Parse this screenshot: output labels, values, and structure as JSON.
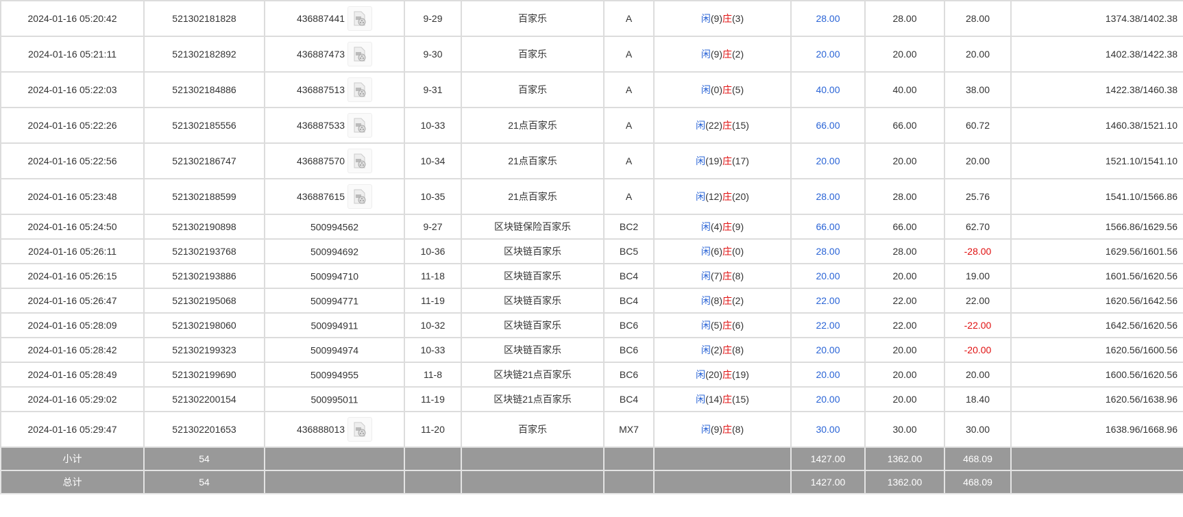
{
  "colors": {
    "player": "#2a64d6",
    "banker": "#e01010",
    "summary_bg": "#999999"
  },
  "labels": {
    "player": "闲",
    "banker": "庄"
  },
  "rows": [
    {
      "time": "2024-01-16 05:20:42",
      "order": "521302181828",
      "round": "436887441",
      "video": true,
      "shoe": "9-29",
      "game": "百家乐",
      "table": "A",
      "player": "9",
      "banker": "3",
      "bet": "28.00",
      "valid": "28.00",
      "win": "28.00",
      "neg": false,
      "balance": "1374.38/1402.38"
    },
    {
      "time": "2024-01-16 05:21:11",
      "order": "521302182892",
      "round": "436887473",
      "video": true,
      "shoe": "9-30",
      "game": "百家乐",
      "table": "A",
      "player": "9",
      "banker": "2",
      "bet": "20.00",
      "valid": "20.00",
      "win": "20.00",
      "neg": false,
      "balance": "1402.38/1422.38"
    },
    {
      "time": "2024-01-16 05:22:03",
      "order": "521302184886",
      "round": "436887513",
      "video": true,
      "shoe": "9-31",
      "game": "百家乐",
      "table": "A",
      "player": "0",
      "banker": "5",
      "bet": "40.00",
      "valid": "40.00",
      "win": "38.00",
      "neg": false,
      "balance": "1422.38/1460.38"
    },
    {
      "time": "2024-01-16 05:22:26",
      "order": "521302185556",
      "round": "436887533",
      "video": true,
      "shoe": "10-33",
      "game": "21点百家乐",
      "table": "A",
      "player": "22",
      "banker": "15",
      "bet": "66.00",
      "valid": "66.00",
      "win": "60.72",
      "neg": false,
      "balance": "1460.38/1521.10"
    },
    {
      "time": "2024-01-16 05:22:56",
      "order": "521302186747",
      "round": "436887570",
      "video": true,
      "shoe": "10-34",
      "game": "21点百家乐",
      "table": "A",
      "player": "19",
      "banker": "17",
      "bet": "20.00",
      "valid": "20.00",
      "win": "20.00",
      "neg": false,
      "balance": "1521.10/1541.10"
    },
    {
      "time": "2024-01-16 05:23:48",
      "order": "521302188599",
      "round": "436887615",
      "video": true,
      "shoe": "10-35",
      "game": "21点百家乐",
      "table": "A",
      "player": "12",
      "banker": "20",
      "bet": "28.00",
      "valid": "28.00",
      "win": "25.76",
      "neg": false,
      "balance": "1541.10/1566.86"
    },
    {
      "time": "2024-01-16 05:24:50",
      "order": "521302190898",
      "round": "500994562",
      "video": false,
      "shoe": "9-27",
      "game": "区块链保险百家乐",
      "table": "BC2",
      "player": "4",
      "banker": "9",
      "bet": "66.00",
      "valid": "66.00",
      "win": "62.70",
      "neg": false,
      "balance": "1566.86/1629.56"
    },
    {
      "time": "2024-01-16 05:26:11",
      "order": "521302193768",
      "round": "500994692",
      "video": false,
      "shoe": "10-36",
      "game": "区块链百家乐",
      "table": "BC5",
      "player": "6",
      "banker": "0",
      "bet": "28.00",
      "valid": "28.00",
      "win": "-28.00",
      "neg": true,
      "balance": "1629.56/1601.56"
    },
    {
      "time": "2024-01-16 05:26:15",
      "order": "521302193886",
      "round": "500994710",
      "video": false,
      "shoe": "11-18",
      "game": "区块链百家乐",
      "table": "BC4",
      "player": "7",
      "banker": "8",
      "bet": "20.00",
      "valid": "20.00",
      "win": "19.00",
      "neg": false,
      "balance": "1601.56/1620.56"
    },
    {
      "time": "2024-01-16 05:26:47",
      "order": "521302195068",
      "round": "500994771",
      "video": false,
      "shoe": "11-19",
      "game": "区块链百家乐",
      "table": "BC4",
      "player": "8",
      "banker": "2",
      "bet": "22.00",
      "valid": "22.00",
      "win": "22.00",
      "neg": false,
      "balance": "1620.56/1642.56"
    },
    {
      "time": "2024-01-16 05:28:09",
      "order": "521302198060",
      "round": "500994911",
      "video": false,
      "shoe": "10-32",
      "game": "区块链百家乐",
      "table": "BC6",
      "player": "5",
      "banker": "6",
      "bet": "22.00",
      "valid": "22.00",
      "win": "-22.00",
      "neg": true,
      "balance": "1642.56/1620.56"
    },
    {
      "time": "2024-01-16 05:28:42",
      "order": "521302199323",
      "round": "500994974",
      "video": false,
      "shoe": "10-33",
      "game": "区块链百家乐",
      "table": "BC6",
      "player": "2",
      "banker": "8",
      "bet": "20.00",
      "valid": "20.00",
      "win": "-20.00",
      "neg": true,
      "balance": "1620.56/1600.56"
    },
    {
      "time": "2024-01-16 05:28:49",
      "order": "521302199690",
      "round": "500994955",
      "video": false,
      "shoe": "11-8",
      "game": "区块链21点百家乐",
      "table": "BC6",
      "player": "20",
      "banker": "19",
      "bet": "20.00",
      "valid": "20.00",
      "win": "20.00",
      "neg": false,
      "balance": "1600.56/1620.56"
    },
    {
      "time": "2024-01-16 05:29:02",
      "order": "521302200154",
      "round": "500995011",
      "video": false,
      "shoe": "11-19",
      "game": "区块链21点百家乐",
      "table": "BC4",
      "player": "14",
      "banker": "15",
      "bet": "20.00",
      "valid": "20.00",
      "win": "18.40",
      "neg": false,
      "balance": "1620.56/1638.96"
    },
    {
      "time": "2024-01-16 05:29:47",
      "order": "521302201653",
      "round": "436888013",
      "video": true,
      "shoe": "11-20",
      "game": "百家乐",
      "table": "MX7",
      "player": "9",
      "banker": "8",
      "bet": "30.00",
      "valid": "30.00",
      "win": "30.00",
      "neg": false,
      "balance": "1638.96/1668.96"
    }
  ],
  "summary": [
    {
      "label": "小计",
      "count": "54",
      "bet": "1427.00",
      "valid": "1362.00",
      "win": "468.09"
    },
    {
      "label": "总计",
      "count": "54",
      "bet": "1427.00",
      "valid": "1362.00",
      "win": "468.09"
    }
  ]
}
